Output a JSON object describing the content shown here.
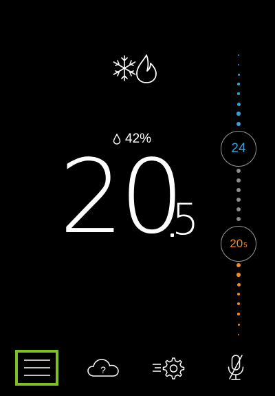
{
  "mode": {
    "cool_icon": "snowflake-icon",
    "heat_icon": "flame-icon"
  },
  "humidity": {
    "icon": "droplet-icon",
    "value": "42%"
  },
  "temperature": {
    "whole": "20",
    "decimal": "5"
  },
  "setpoints": {
    "cool": "24",
    "heat_whole": "20",
    "heat_decimal": "5"
  },
  "colors": {
    "cool": "#36a0d8",
    "neutral": "#8c8c8c",
    "heat": "#ef8a25",
    "nav_active": "#7fbf1f"
  },
  "nav": {
    "items": [
      {
        "icon": "menu-icon",
        "active": true
      },
      {
        "icon": "cloud-help-icon",
        "active": false
      },
      {
        "icon": "settings-gear-icon",
        "active": false
      },
      {
        "icon": "microphone-muted-icon",
        "active": false
      }
    ]
  }
}
